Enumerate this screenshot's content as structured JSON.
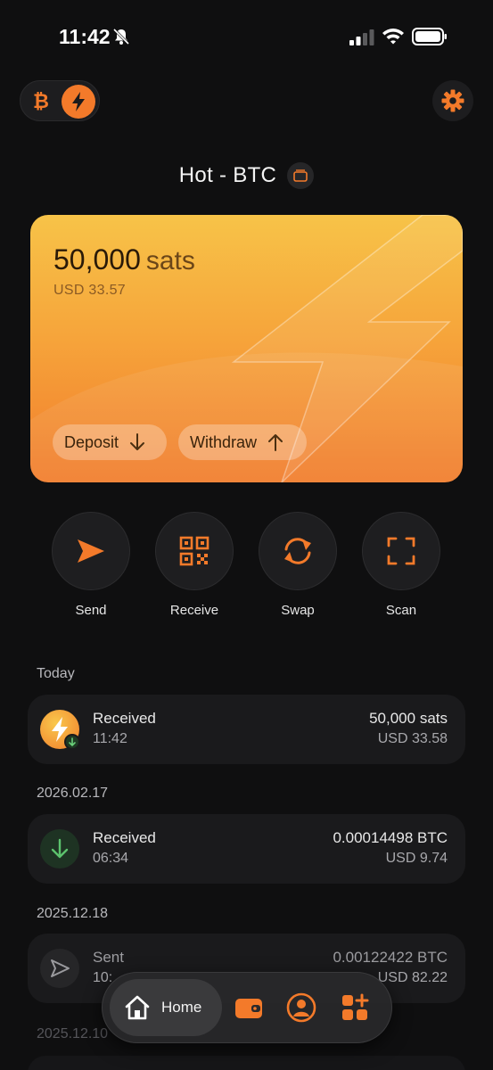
{
  "status_bar": {
    "time": "11:42"
  },
  "wallet": {
    "name": "Hot - BTC"
  },
  "card": {
    "balance": "50,000",
    "unit": "sats",
    "fiat": "USD 33.57",
    "deposit_label": "Deposit",
    "withdraw_label": "Withdraw"
  },
  "actions": [
    {
      "label": "Send"
    },
    {
      "label": "Receive"
    },
    {
      "label": "Swap"
    },
    {
      "label": "Scan"
    }
  ],
  "transactions": [
    {
      "date": "Today",
      "type": "Received",
      "time": "11:42",
      "amount": "50,000 sats",
      "fiat": "USD 33.58"
    },
    {
      "date": "2026.02.17",
      "type": "Received",
      "time": "06:34",
      "amount": "0.00014498 BTC",
      "fiat": "USD 9.74"
    },
    {
      "date": "2025.12.18",
      "type": "Sent",
      "time": "10:",
      "amount": "0.00122422 BTC",
      "fiat": "USD 82.22"
    },
    {
      "date": "2025.12.10"
    }
  ],
  "nav": {
    "home_label": "Home"
  },
  "colors": {
    "accent": "#f37a2a",
    "background": "#0f0f10",
    "card_top": "#f7c348",
    "card_bottom": "#f17c2c"
  }
}
